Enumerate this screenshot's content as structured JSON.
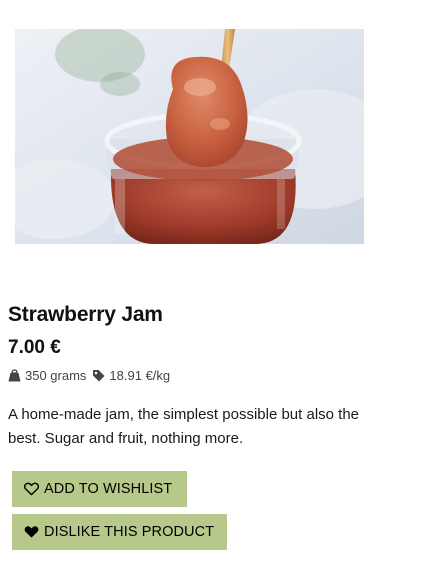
{
  "product": {
    "image_alt": "Strawberry jam in a glass jar with a spoon",
    "title": "Strawberry Jam",
    "price": "7.00 €",
    "weight": "350 grams",
    "price_per_kg": "18.91 €/kg",
    "description": "A home-made jam, the simplest possible but also the best. Sugar and fruit, nothing more."
  },
  "actions": {
    "wishlist_label": "ADD TO WISHLIST",
    "dislike_label": "DISLIKE THIS PRODUCT"
  },
  "icons": {
    "weight": "weight-icon",
    "price_tag": "tag-icon",
    "wishlist": "heart-outline-icon",
    "dislike": "heart-filled-icon"
  },
  "colors": {
    "button_background": "#b7c98a",
    "text": "#111111"
  }
}
